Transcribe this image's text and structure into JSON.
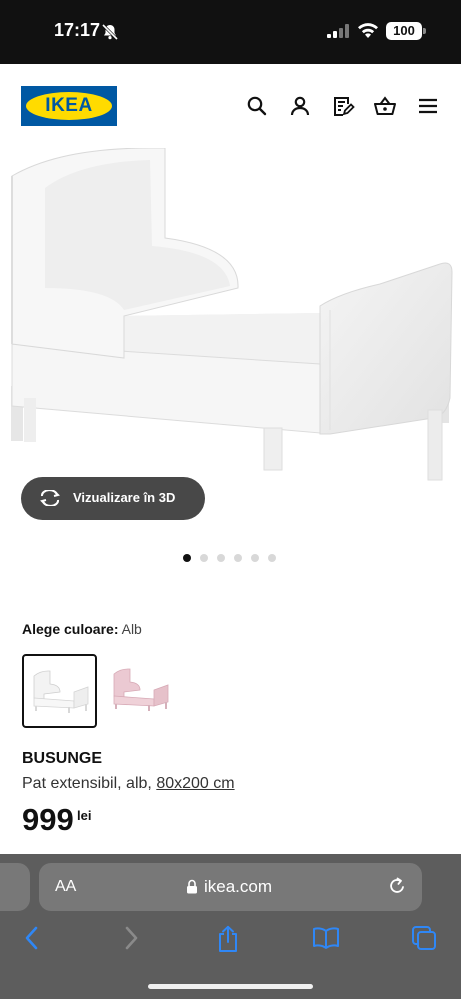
{
  "status_bar": {
    "time": "17:17",
    "battery": "100",
    "icons": [
      "bell-slash-icon",
      "signal-icon",
      "wifi-icon",
      "battery-icon"
    ]
  },
  "header": {
    "logo_text": "IKEA",
    "icons": [
      "search-icon",
      "user-icon",
      "shopping-list-icon",
      "basket-icon",
      "menu-icon"
    ]
  },
  "product": {
    "view3d_label": "Vizualizare în 3D",
    "carousel_total": 6,
    "carousel_active": 1,
    "color_label": "Alege culoare:",
    "color_value": "Alb",
    "swatches": [
      "white",
      "pink"
    ],
    "name": "BUSUNGE",
    "description": "Pat extensibil, alb,",
    "size": "80x200 cm",
    "price": "999",
    "currency": "lei"
  },
  "browser": {
    "aa_label": "AA",
    "url": "ikea.com",
    "icons": [
      "back-icon",
      "forward-icon",
      "share-icon",
      "bookmarks-icon",
      "tabs-icon"
    ]
  },
  "colors": {
    "ikea_blue": "#0058A3",
    "ikea_yellow": "#FFDB00",
    "ios_blue": "#2f87f6",
    "browser_bg": "#5d5d5d",
    "pink_swatch": "#e9c6cf"
  }
}
